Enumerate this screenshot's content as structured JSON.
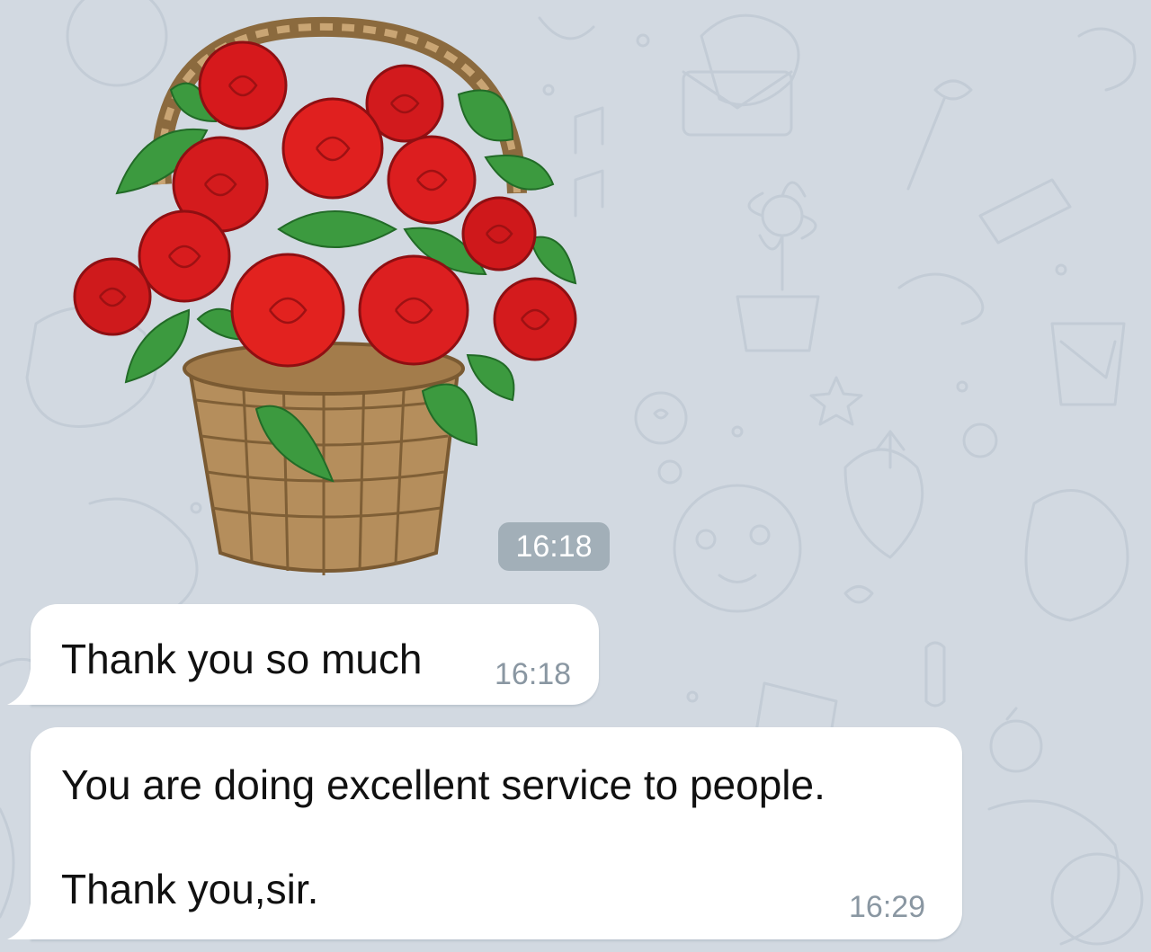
{
  "chat": {
    "wallpaper": "chat-doodle-pattern",
    "background_color": "#d2d9e1",
    "incoming_bubble_color": "#ffffff",
    "sticker": {
      "icon": "rose-basket-sticker",
      "time": "16:18"
    },
    "messages": [
      {
        "lines": [
          "Thank you so much"
        ],
        "time": "16:18"
      },
      {
        "lines": [
          "You are doing excellent service to people.",
          "Thank you,sir."
        ],
        "time": "16:29"
      }
    ]
  }
}
